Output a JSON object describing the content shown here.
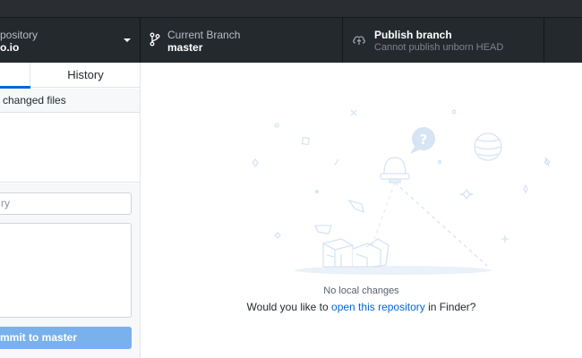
{
  "toolbar": {
    "repository": {
      "label": "Current Repository",
      "visible_label": "pository",
      "name": "...o.io",
      "visible_name": "o.io"
    },
    "branch": {
      "label": "Current Branch",
      "name": "master"
    },
    "publish": {
      "title": "Publish branch",
      "subtitle": "Cannot publish unborn HEAD"
    }
  },
  "sidebar": {
    "tabs": {
      "history": "History"
    },
    "changed_files": "changed files",
    "summary_placeholder": "ry",
    "commit_button": {
      "prefix": "mmit to ",
      "branch": "master"
    }
  },
  "main": {
    "title": "No local changes",
    "prompt_prefix": "Would you like to ",
    "link": "open this repository",
    "prompt_suffix": " in Finder?"
  },
  "icons": {
    "repo_dropdown": "chevron-down-icon",
    "branch": "git-branch-icon",
    "publish": "cloud-upload-icon"
  },
  "colors": {
    "toolbar": "#24292e",
    "accent": "#0366d6",
    "commit_button": "#79b1ec",
    "illustration": "#d6e4f3"
  }
}
